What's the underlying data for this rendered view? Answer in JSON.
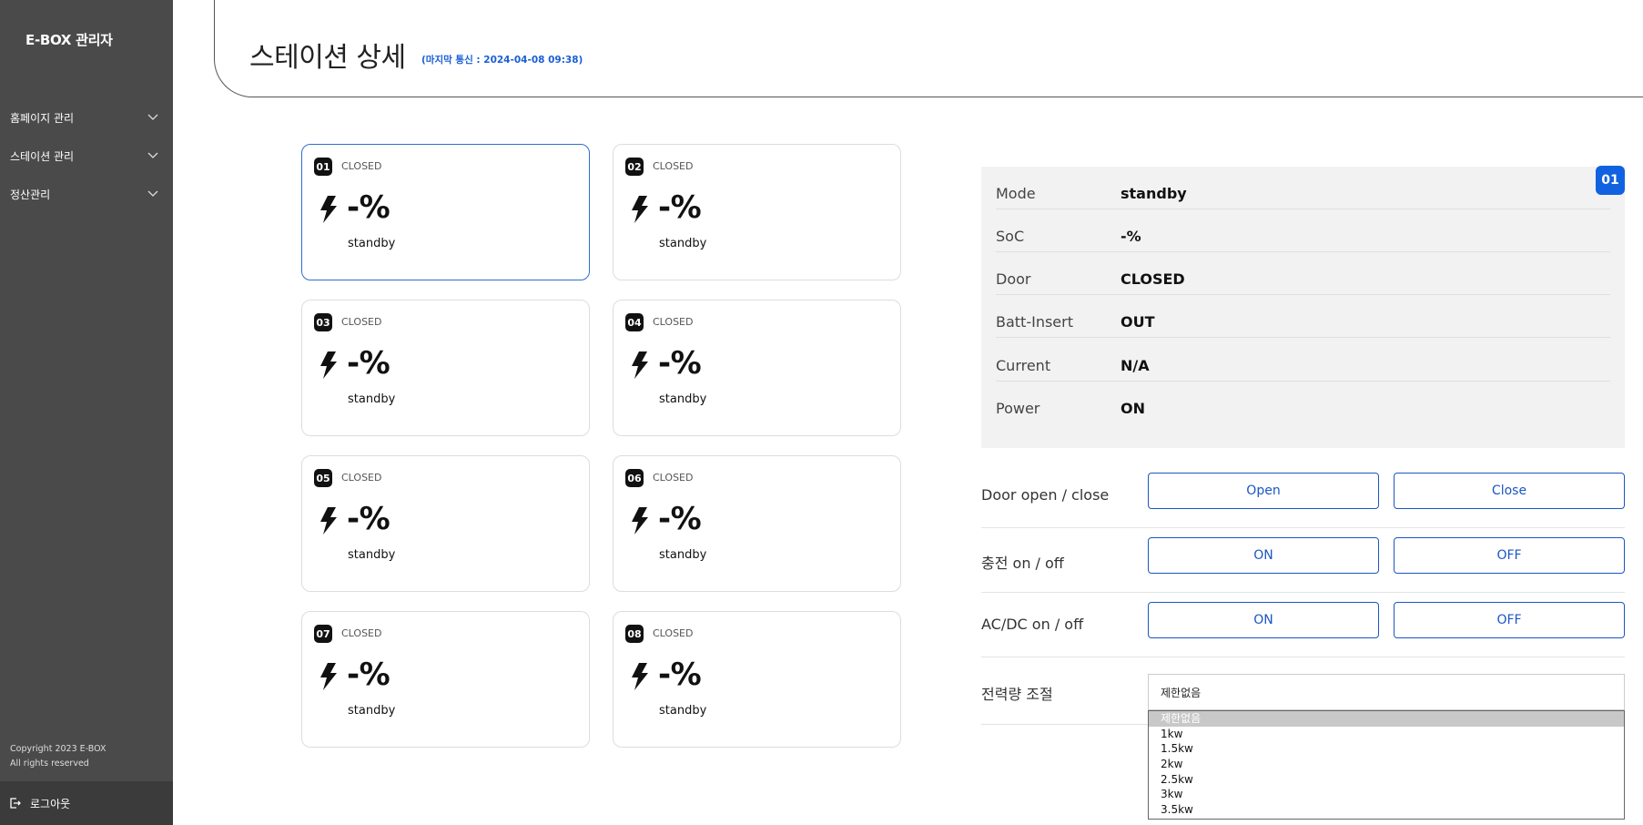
{
  "sidebar": {
    "brand": "E-BOX 관리자",
    "menu": [
      {
        "label": "홈페이지 관리"
      },
      {
        "label": "스테이션 관리"
      },
      {
        "label": "정산관리"
      }
    ],
    "copyright_line1": "Copyright 2023 E-BOX",
    "copyright_line2": "All rights reserved",
    "logout_label": "로그아웃"
  },
  "header": {
    "title": "스테이션 상세",
    "last_comm": "(마지막 통신 : 2024-04-08 09:38)"
  },
  "slots": [
    {
      "num": "01",
      "door": "CLOSED",
      "soc": "-%",
      "mode": "standby"
    },
    {
      "num": "02",
      "door": "CLOSED",
      "soc": "-%",
      "mode": "standby"
    },
    {
      "num": "03",
      "door": "CLOSED",
      "soc": "-%",
      "mode": "standby"
    },
    {
      "num": "04",
      "door": "CLOSED",
      "soc": "-%",
      "mode": "standby"
    },
    {
      "num": "05",
      "door": "CLOSED",
      "soc": "-%",
      "mode": "standby"
    },
    {
      "num": "06",
      "door": "CLOSED",
      "soc": "-%",
      "mode": "standby"
    },
    {
      "num": "07",
      "door": "CLOSED",
      "soc": "-%",
      "mode": "standby"
    },
    {
      "num": "08",
      "door": "CLOSED",
      "soc": "-%",
      "mode": "standby"
    }
  ],
  "detail": {
    "badge": "01",
    "rows": [
      {
        "label": "Mode",
        "value": "standby"
      },
      {
        "label": "SoC",
        "value": "-%"
      },
      {
        "label": "Door",
        "value": "CLOSED"
      },
      {
        "label": "Batt-Insert",
        "value": "OUT"
      },
      {
        "label": "Current",
        "value": "N/A"
      },
      {
        "label": "Power",
        "value": "ON"
      }
    ]
  },
  "controls": {
    "door": {
      "label": "Door open / close",
      "left": "Open",
      "right": "Close"
    },
    "charge": {
      "label": "충전 on / off",
      "left": "ON",
      "right": "OFF"
    },
    "acdc": {
      "label": "AC/DC on / off",
      "left": "ON",
      "right": "OFF"
    },
    "power": {
      "label": "전력량 조절",
      "selected": "제한없음",
      "options": [
        "제한없음",
        "1kw",
        "1.5kw",
        "2kw",
        "2.5kw",
        "3kw",
        "3.5kw"
      ]
    }
  },
  "colors": {
    "sidebar": "#4a4a4a",
    "accent": "#1a56c2",
    "badge": "#1162e0"
  }
}
